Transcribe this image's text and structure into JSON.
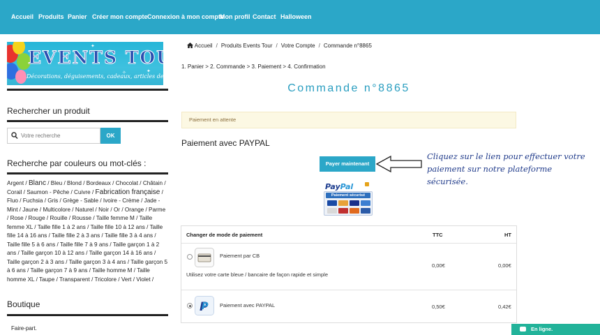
{
  "nav": {
    "items": [
      "Accueil",
      "Produits",
      "Panier",
      "Créer mon compte",
      "Connexion à mon compte",
      "Mon profil",
      "Contact",
      "Halloween"
    ]
  },
  "logo": {
    "title": "EVENTS TOUR",
    "tagline": "Décorations, déguisements, cadeaux, articles de fêtes..."
  },
  "sidebar": {
    "search_heading": "Rechercher un produit",
    "search_placeholder": "Votre recherche",
    "search_button": "OK",
    "tags_heading": "Recherche par couleurs ou mot-clés :",
    "tags": [
      {
        "label": "Argent"
      },
      {
        "label": "Blanc",
        "big": true
      },
      {
        "label": "Bleu"
      },
      {
        "label": "Blond"
      },
      {
        "label": "Bordeaux"
      },
      {
        "label": "Chocolat"
      },
      {
        "label": "Châtain"
      },
      {
        "label": "Corail"
      },
      {
        "label": "Saumon - Pêche"
      },
      {
        "label": "Cuivre"
      },
      {
        "label": "Fabrication française",
        "big": true
      },
      {
        "label": "Fluo"
      },
      {
        "label": "Fuchsia"
      },
      {
        "label": "Gris"
      },
      {
        "label": "Grège - Sable"
      },
      {
        "label": "Ivoire - Crème"
      },
      {
        "label": "Jade - Mint"
      },
      {
        "label": "Jaune"
      },
      {
        "label": "Multicolore"
      },
      {
        "label": "Naturel"
      },
      {
        "label": "Noir"
      },
      {
        "label": "Or"
      },
      {
        "label": "Orange"
      },
      {
        "label": "Parme"
      },
      {
        "label": "Rose"
      },
      {
        "label": "Rouge"
      },
      {
        "label": "Rouille"
      },
      {
        "label": "Rousse"
      },
      {
        "label": "Taille femme M"
      },
      {
        "label": "Taille femme XL"
      },
      {
        "label": "Taille fille 1 à 2 ans"
      },
      {
        "label": "Taille fille 10 à 12 ans"
      },
      {
        "label": "Taille fille 14 à 16 ans"
      },
      {
        "label": "Taille fille 2 à 3 ans"
      },
      {
        "label": "Taille fille 3 à 4 ans"
      },
      {
        "label": "Taille fille 5 à 6 ans"
      },
      {
        "label": "Taille fille 7 à 9 ans"
      },
      {
        "label": "Taille garçon 1 à 2 ans"
      },
      {
        "label": "Taille garçon 10 à 12 ans"
      },
      {
        "label": "Taille garçon 14 à 16 ans"
      },
      {
        "label": "Taille garçon 2 à 3 ans"
      },
      {
        "label": "Taille garçon 3 à 4 ans"
      },
      {
        "label": "Taille garçon 5 à 6 ans"
      },
      {
        "label": "Taille garçon 7 à 9 ans"
      },
      {
        "label": "Taille homme M"
      },
      {
        "label": "Taille homme XL"
      },
      {
        "label": "Taupe"
      },
      {
        "label": "Transparent"
      },
      {
        "label": "Tricolore"
      },
      {
        "label": "Vert"
      },
      {
        "label": "Violet"
      }
    ],
    "boutique_heading": "Boutique",
    "boutique_first_item": "Faire-part."
  },
  "breadcrumb": [
    "Accueil",
    "Produits Events Tour",
    "Votre Compte",
    "Commande n°8865"
  ],
  "steps": "1. Panier > 2. Commande > 3. Paiement > 4. Confirmation",
  "order_title": "Commande n°8865",
  "alert": "Paiement en attente",
  "payment": {
    "heading": "Paiement avec PAYPAL",
    "button": "Payer maintenant",
    "annotation": "Cliquez sur le lien pour effectuer votre paiement sur notre plateforme sécurisée.",
    "paypal_word_1": "Pay",
    "paypal_word_2": "Pal",
    "badge_text": "Paiement sécurisé"
  },
  "methods_table": {
    "header": "Changer de mode de paiement",
    "col_ttc": "TTC",
    "col_ht": "HT",
    "rows": [
      {
        "label": "Paiement par CB",
        "desc": "Utilisez votre carte bleue / bancaire de façon rapide et simple",
        "ttc": "0,00€",
        "ht": "0,00€",
        "selected": false
      },
      {
        "label": "Paiement avec PAYPAL",
        "desc": "",
        "ttc": "0,50€",
        "ht": "0,42€",
        "selected": true
      }
    ]
  },
  "chat": {
    "label": "En ligne."
  },
  "colors": {
    "accent": "#2ba7c8",
    "alert_bg": "#fcf8e3",
    "chat": "#22b39a",
    "annotation": "#1f3a8a"
  }
}
